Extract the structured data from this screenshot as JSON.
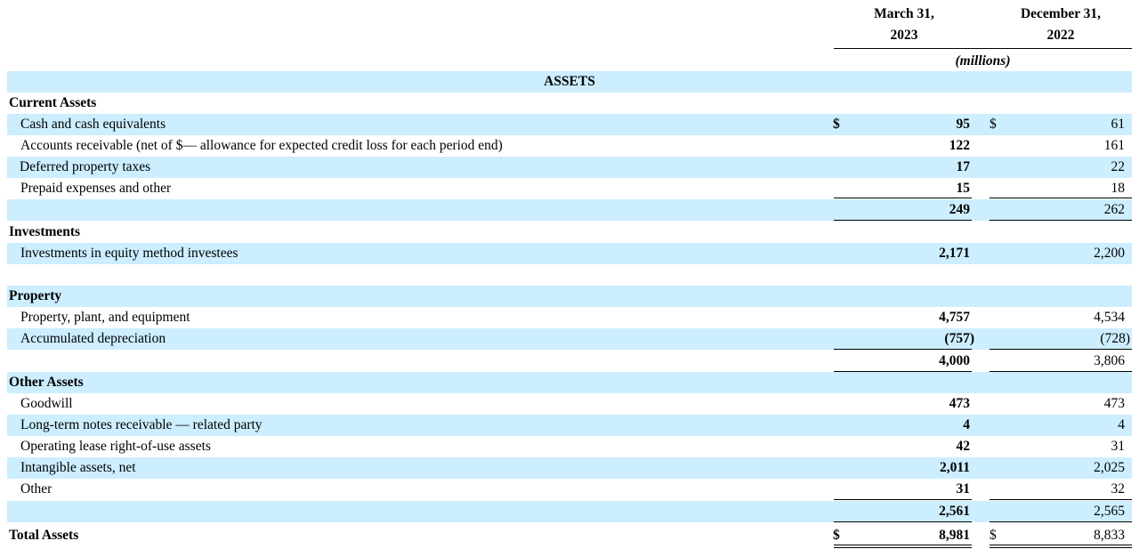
{
  "header": {
    "col_a_line1": "March 31,",
    "col_a_line2": "2023",
    "col_b_line1": "December 31,",
    "col_b_line2": "2022",
    "units": "(millions)"
  },
  "title": "ASSETS",
  "rows": {
    "current_assets": {
      "label": "Current Assets"
    },
    "cash": {
      "label": "Cash and cash equivalents",
      "cur_a": "$",
      "a": "95",
      "cur_b": "$",
      "b": "61"
    },
    "ar": {
      "label": "Accounts receivable (net of $— allowance for expected credit loss for each period end)",
      "a": "122",
      "b": "161"
    },
    "deferred": {
      "label": "Deferred property taxes",
      "a": "17",
      "b": "22"
    },
    "prepaid": {
      "label": "Prepaid expenses and other",
      "a": "15",
      "b": "18"
    },
    "current_total": {
      "a": "249",
      "b": "262"
    },
    "investments": {
      "label": "Investments"
    },
    "equity_method": {
      "label": "Investments in equity method investees",
      "a": "2,171",
      "b": "2,200"
    },
    "property": {
      "label": "Property"
    },
    "ppe": {
      "label": "Property, plant, and equipment",
      "a": "4,757",
      "b": "4,534"
    },
    "accum_dep": {
      "label": "Accumulated depreciation",
      "a": "(757)",
      "b": "(728)"
    },
    "property_total": {
      "a": "4,000",
      "b": "3,806"
    },
    "other_assets": {
      "label": "Other Assets"
    },
    "goodwill": {
      "label": "Goodwill",
      "a": "473",
      "b": "473"
    },
    "notes_rec": {
      "label": "Long-term notes receivable — related party",
      "a": "4",
      "b": "4"
    },
    "lease_rou": {
      "label": "Operating lease right-of-use assets",
      "a": "42",
      "b": "31"
    },
    "intangible": {
      "label": "Intangible assets, net",
      "a": "2,011",
      "b": "2,025"
    },
    "other": {
      "label": "Other",
      "a": "31",
      "b": "32"
    },
    "other_total": {
      "a": "2,561",
      "b": "2,565"
    },
    "total_assets": {
      "label": "Total Assets",
      "cur_a": "$",
      "a": "8,981",
      "cur_b": "$",
      "b": "8,833"
    }
  }
}
